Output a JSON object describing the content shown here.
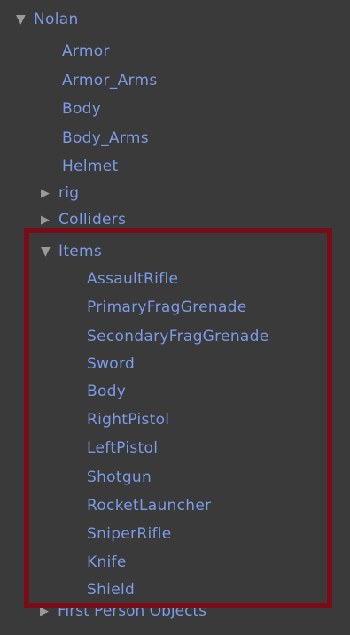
{
  "hierarchy": {
    "root": {
      "label": "Nolan",
      "expanded": true
    },
    "children": [
      {
        "label": "Armor",
        "type": "leaf"
      },
      {
        "label": "Armor_Arms",
        "type": "leaf"
      },
      {
        "label": "Body",
        "type": "leaf"
      },
      {
        "label": "Body_Arms",
        "type": "leaf"
      },
      {
        "label": "Helmet",
        "type": "leaf"
      },
      {
        "label": "rig",
        "type": "collapsed"
      },
      {
        "label": "Colliders",
        "type": "collapsed"
      }
    ],
    "items_group": {
      "label": "Items",
      "expanded": true,
      "children": [
        "AssaultRifle",
        "PrimaryFragGrenade",
        "SecondaryFragGrenade",
        "Sword",
        "Body",
        "RightPistol",
        "LeftPistol",
        "Shotgun",
        "RocketLauncher",
        "SniperRifle",
        "Knife",
        "Shield"
      ]
    },
    "partial_row": {
      "label": "First Person Objects",
      "type": "collapsed"
    }
  },
  "colors": {
    "background": "#3a3a3a",
    "text": "#7c9be6",
    "arrow": "#9a9a9a",
    "highlight_border": "#7a0c17"
  },
  "icons": {
    "expanded": "triangle-down-icon",
    "collapsed": "triangle-right-icon"
  }
}
